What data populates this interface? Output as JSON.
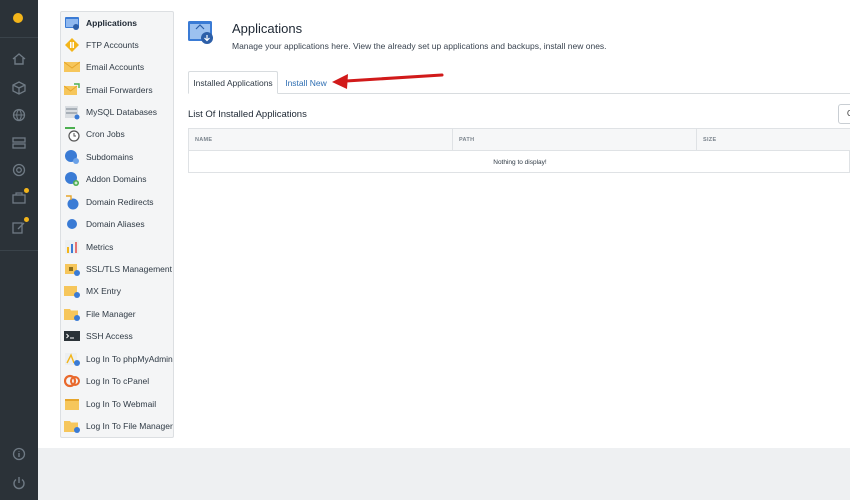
{
  "header": {
    "title": "Applications",
    "description": "Manage your applications here. View the already set up applications and backups, install new ones."
  },
  "tabs": [
    {
      "label": "Installed Applications",
      "active": true
    },
    {
      "label": "Install New",
      "active": false
    }
  ],
  "section": {
    "title": "List Of Installed Applications",
    "corner_button": "C"
  },
  "table": {
    "columns": [
      "NAME",
      "PATH",
      "SIZE"
    ],
    "empty_message": "Nothing to display!"
  },
  "sidebar": {
    "items": [
      {
        "label": "Applications",
        "icon": "applications-icon",
        "active": true
      },
      {
        "label": "FTP Accounts",
        "icon": "ftp-icon"
      },
      {
        "label": "Email Accounts",
        "icon": "email-icon"
      },
      {
        "label": "Email Forwarders",
        "icon": "email-forwarders-icon"
      },
      {
        "label": "MySQL Databases",
        "icon": "database-icon"
      },
      {
        "label": "Cron Jobs",
        "icon": "cron-icon"
      },
      {
        "label": "Subdomains",
        "icon": "subdomains-icon"
      },
      {
        "label": "Addon Domains",
        "icon": "addon-domains-icon"
      },
      {
        "label": "Domain Redirects",
        "icon": "domain-redirects-icon"
      },
      {
        "label": "Domain Aliases",
        "icon": "domain-aliases-icon"
      },
      {
        "label": "Metrics",
        "icon": "metrics-icon"
      },
      {
        "label": "SSL/TLS Management",
        "icon": "ssl-icon"
      },
      {
        "label": "MX Entry",
        "icon": "mx-icon"
      },
      {
        "label": "File Manager",
        "icon": "file-manager-icon"
      },
      {
        "label": "SSH Access",
        "icon": "ssh-icon"
      },
      {
        "label": "Log In To phpMyAdmin",
        "icon": "phpmyadmin-icon"
      },
      {
        "label": "Log In To cPanel",
        "icon": "cpanel-icon"
      },
      {
        "label": "Log In To Webmail",
        "icon": "webmail-icon"
      },
      {
        "label": "Log In To File Manager",
        "icon": "login-file-manager-icon"
      }
    ]
  },
  "colors": {
    "rail": "#2b3238",
    "accent": "#f3b51a",
    "link": "#2f6fb3",
    "arrow": "#d11a1a"
  }
}
